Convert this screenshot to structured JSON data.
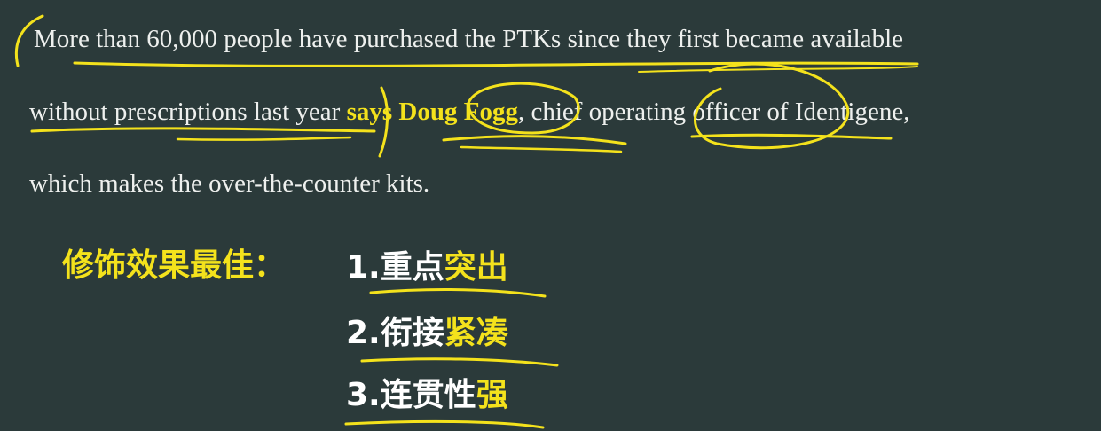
{
  "passage": {
    "line1": "More than 60,000 people have purchased the PTKs since they first became available",
    "line2_before": "without prescriptions last year",
    "line2_highlight": "says Doug Fogg",
    "line2_after": ", chief operating officer of Identigene,",
    "line3": "which makes the over-the-counter kits."
  },
  "summary": {
    "heading": "修饰效果最佳：",
    "points": [
      {
        "plain": "1.重点",
        "emphasis": "突出"
      },
      {
        "plain": "2.衔接",
        "emphasis": "紧凑"
      },
      {
        "plain": "3.连贯性",
        "emphasis": "强"
      }
    ]
  },
  "colors": {
    "background": "#2b3a3a",
    "text": "#eef0ee",
    "accent": "#f4e21c"
  }
}
